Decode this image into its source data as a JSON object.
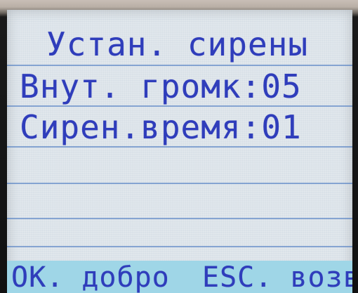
{
  "screen": {
    "title": "Устан. сирены",
    "menu_items": [
      {
        "label": "Внут. громк:05"
      },
      {
        "label": "Сирен.время:01"
      },
      {
        "label": ""
      },
      {
        "label": ""
      },
      {
        "label": ""
      }
    ],
    "footer": {
      "left_softkey": "OK. добро",
      "right_softkey": "ESC. возвр"
    }
  },
  "colors": {
    "lcd_background": "#d7dfe6",
    "text": "#2f3dbb",
    "divider": "#3d70be",
    "footer_background": "#9fd6e7"
  }
}
